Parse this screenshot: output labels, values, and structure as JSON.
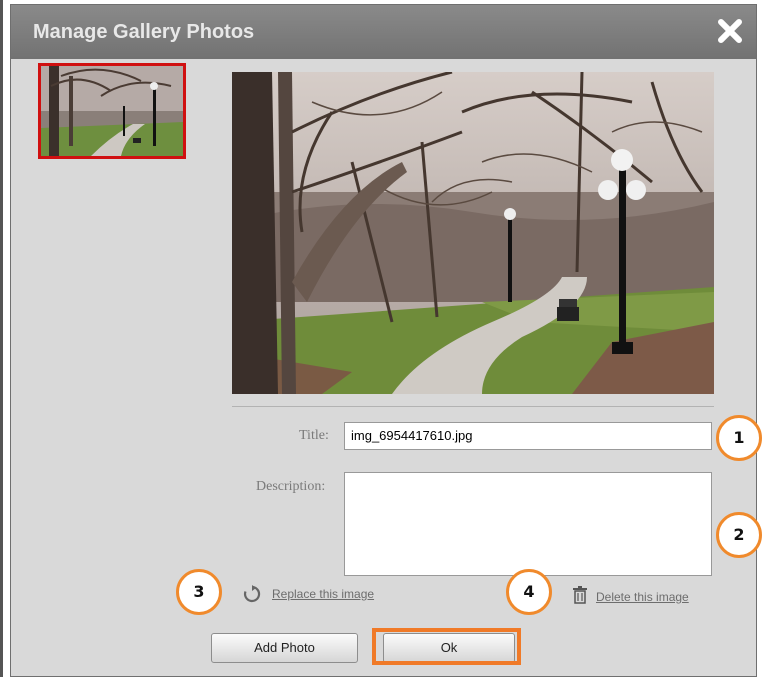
{
  "dialog": {
    "title": "Manage Gallery Photos",
    "close_icon": "close-icon"
  },
  "form": {
    "title_label": "Title:",
    "title_value": "img_6954417610.jpg",
    "description_label": "Description:",
    "description_value": ""
  },
  "actions": {
    "replace_label": "Replace this image",
    "replace_icon": "refresh-icon",
    "delete_label": "Delete this image",
    "delete_icon": "trash-icon"
  },
  "buttons": {
    "add_photo": "Add Photo",
    "ok": "Ok"
  },
  "callouts": [
    "1",
    "2",
    "3",
    "4"
  ],
  "colors": {
    "title_bar": "#7a7a7a",
    "dialog_bg": "#d9d9d9",
    "selected_thumb_border": "#d01010",
    "callout_border": "#f08a2c",
    "ok_highlight": "#f07a28"
  }
}
